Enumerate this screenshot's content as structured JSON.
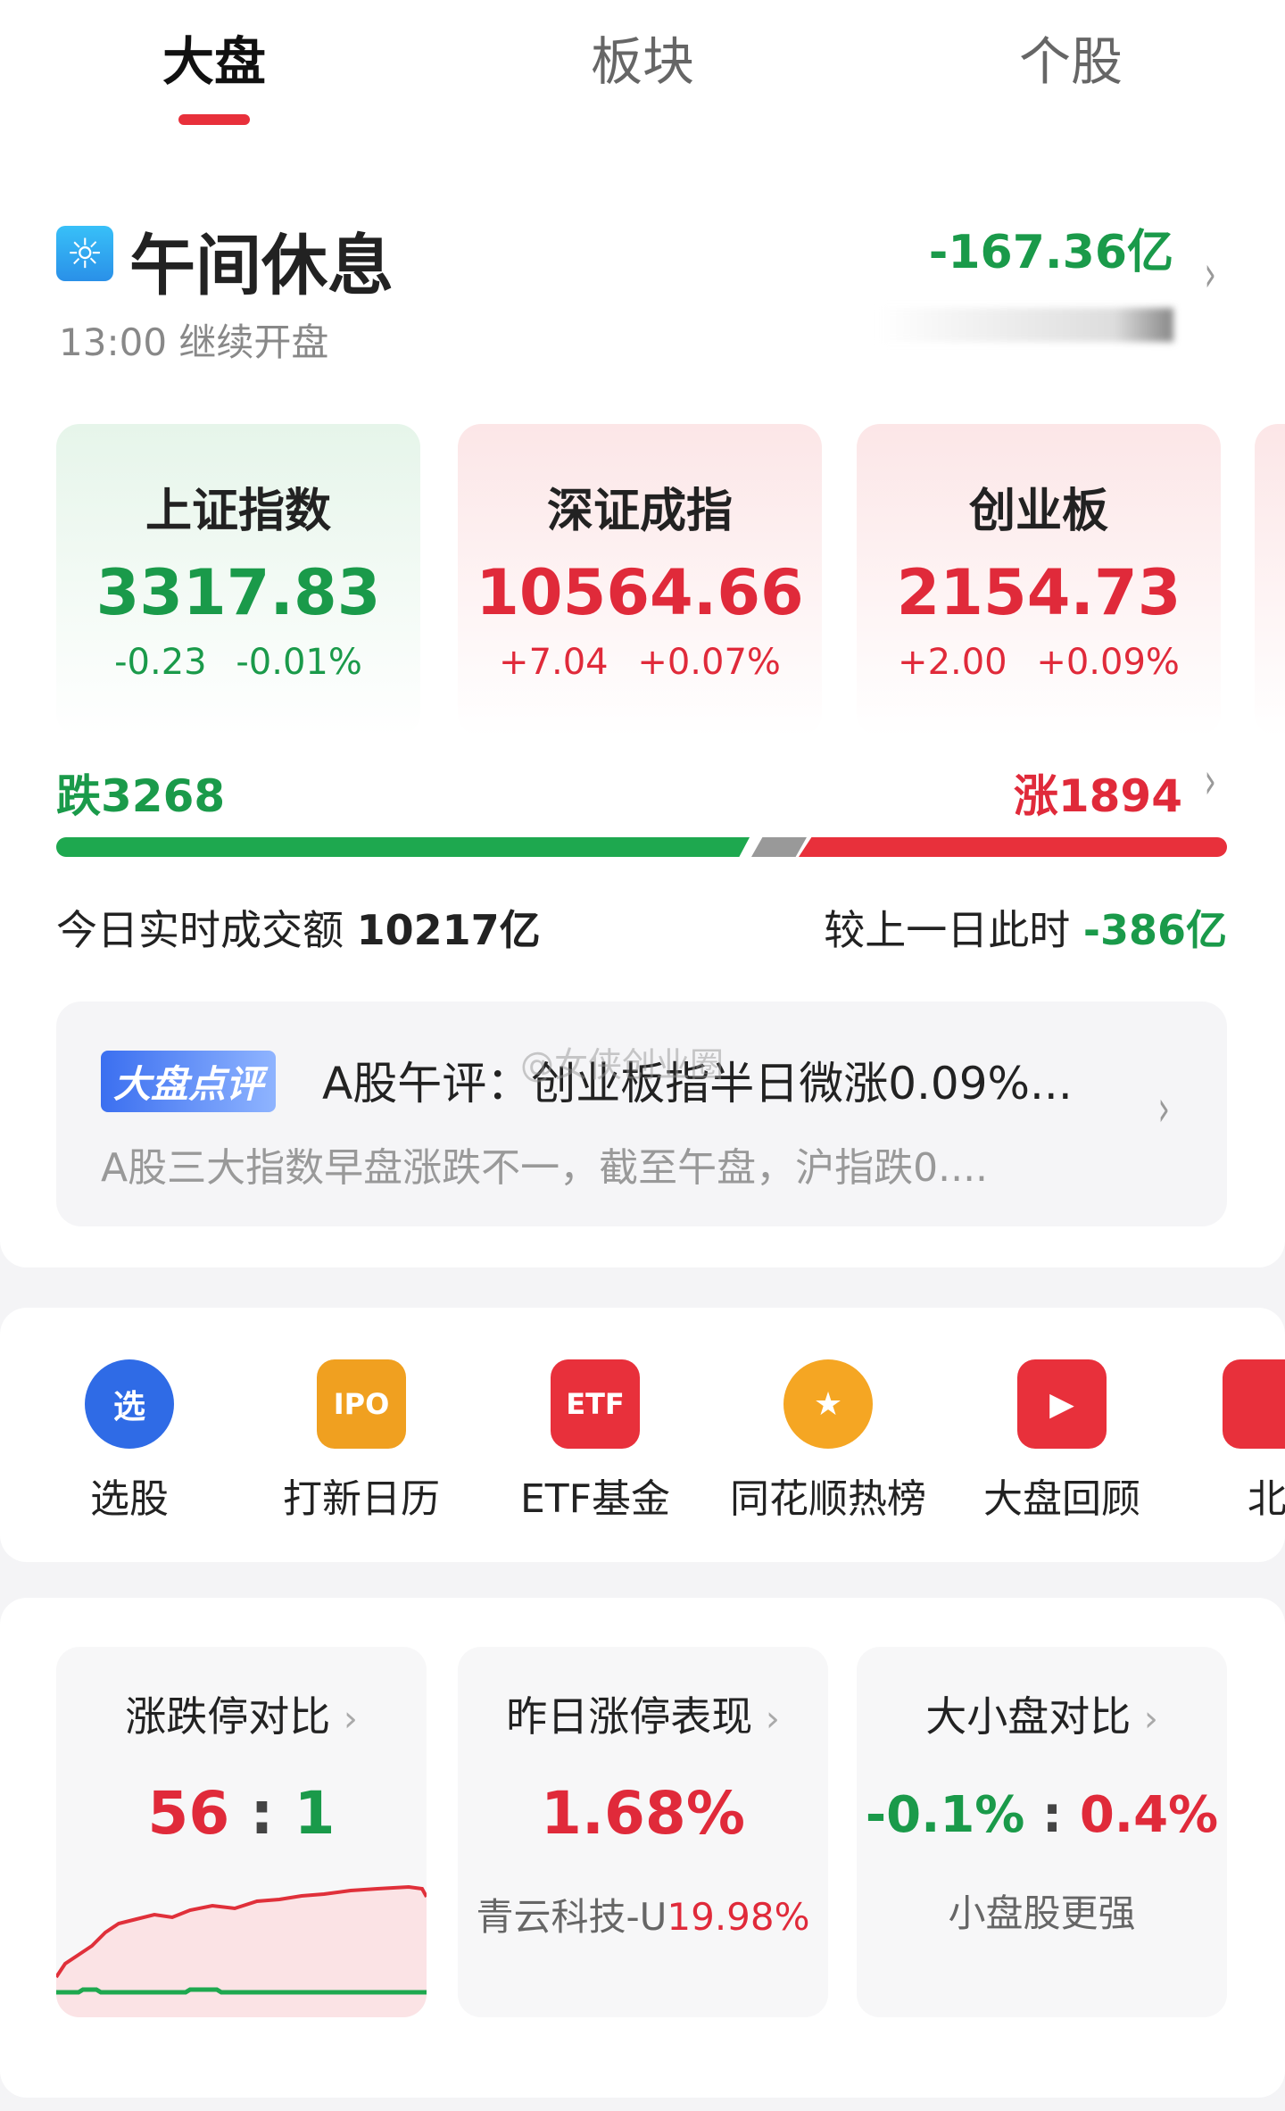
{
  "tabs": [
    {
      "label": "大盘",
      "active": true
    },
    {
      "label": "板块"
    },
    {
      "label": "个股"
    }
  ],
  "status": {
    "title": "午间休息",
    "subtitle": "13:00 继续开盘",
    "net_flow": "-167.36亿"
  },
  "indices": [
    {
      "name": "上证指数",
      "value": "3317.83",
      "change": "-0.23",
      "pct": "-0.01%",
      "trend": "down"
    },
    {
      "name": "深证成指",
      "value": "10564.66",
      "change": "+7.04",
      "pct": "+0.07%",
      "trend": "up"
    },
    {
      "name": "创业板",
      "value": "2154.73",
      "change": "+2.00",
      "pct": "+0.09%",
      "trend": "up"
    }
  ],
  "breadth": {
    "down_label": "跌3268",
    "up_label": "涨1894",
    "down": 3268,
    "up": 1894
  },
  "turnover": {
    "label": "今日实时成交额",
    "value": "10217亿",
    "compare_label": "较上一日此时",
    "compare_value": "-386亿"
  },
  "commentary": {
    "badge": "大盘点评",
    "title": "A股午评：创业板指半日微涨0.09%...",
    "summary": "A股三大指数早盘涨跌不一，截至午盘，沪指跌0....",
    "watermark": "@女侠创业圈"
  },
  "shortcuts": [
    {
      "label": "选股",
      "icon": "stock-picker-icon",
      "glyph": "选",
      "color": "#2f6be6"
    },
    {
      "label": "打新日历",
      "icon": "ipo-calendar-icon",
      "glyph": "IPO",
      "color": "#f0a020"
    },
    {
      "label": "ETF基金",
      "icon": "etf-icon",
      "glyph": "ETF",
      "color": "#e8303b"
    },
    {
      "label": "同花顺热榜",
      "icon": "hot-list-medal-icon",
      "glyph": "★",
      "color": "#f5a623"
    },
    {
      "label": "大盘回顾",
      "icon": "market-review-icon",
      "glyph": "▶",
      "color": "#e8303b"
    },
    {
      "label": "北",
      "icon": "north-icon",
      "glyph": "",
      "color": "#e8303b"
    }
  ],
  "stats": [
    {
      "title": "涨跌停对比",
      "up": "56",
      "sep": ":",
      "down": "1"
    },
    {
      "title": "昨日涨停表现",
      "value": "1.68%",
      "stock": "青云科技-U",
      "stock_pct": "19.98%"
    },
    {
      "title": "大小盘对比",
      "left": "-0.1%",
      "sep": ":",
      "right": "0.4%",
      "note": "小盘股更强"
    }
  ],
  "colors": {
    "up": "#e02a3a",
    "down": "#1a9a4a",
    "accent": "#e8303b"
  }
}
